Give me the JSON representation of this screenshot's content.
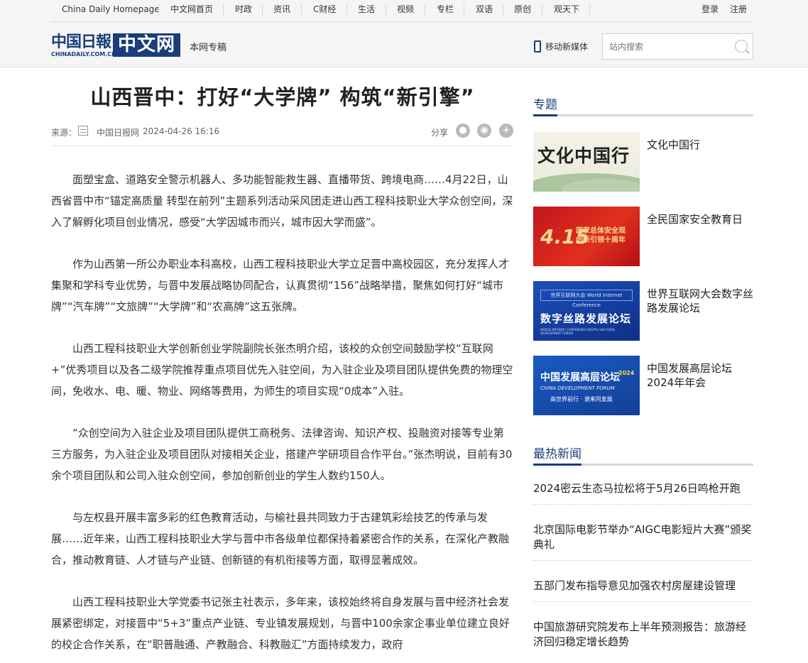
{
  "nav": {
    "items": [
      "China Daily Homepage",
      "中文网首页",
      "时政",
      "资讯",
      "C财经",
      "生活",
      "视频",
      "专栏",
      "双语",
      "原创",
      "观天下"
    ],
    "login": "登录",
    "register": "注册"
  },
  "logo": {
    "cn": "中国日報",
    "en": "CHINADAILY.COM.CN",
    "box": "中文网"
  },
  "header": {
    "column": "本网专稿",
    "mobile": "移动新媒体",
    "search_placeholder": "站内搜索"
  },
  "article": {
    "title": "山西晋中：打好“大学牌” 构筑“新引擎”",
    "source_label": "来源：",
    "source_name": "中国日报网",
    "date": "2024-04-26 16:16",
    "share_label": "分享",
    "paragraphs": [
      "面塑宝盒、道路安全警示机器人、多功能智能救生器、直播带货、跨境电商……4月22日，山西省晋中市“锚定高质量 转型在前列”主题系列活动采风团走进山西工程科技职业大学众创空间，深入了解孵化项目创业情况，感受“大学因城市而兴，城市因大学而盛”。",
      "作为山西第一所公办职业本科高校，山西工程科技职业大学立足晋中高校园区，充分发挥人才集聚和学科专业优势，与晋中发展战略协同配合，认真贯彻“156”战略举措，聚焦如何打好“城市牌”“汽车牌”“文旅牌”“大学牌”和“农高牌”这五张牌。",
      "山西工程科技职业大学创新创业学院副院长张杰明介绍，该校的众创空间鼓励学校“互联网+”优秀项目以及各二级学院推荐重点项目优先入驻空间，为入驻企业及项目团队提供免费的物理空间，免收水、电、暖、物业、网络等费用，为师生的项目实现“0成本”入驻。",
      "“众创空间为入驻企业及项目团队提供工商税务、法律咨询、知识产权、投融资对接等专业第三方服务，为入驻企业及项目团队对接相关企业，搭建产学研项目合作平台。”张杰明说，目前有30余个项目团队和公司入驻众创空间，参加创新创业的学生人数约150人。",
      "与左权县开展丰富多彩的红色教育活动，与榆社县共同致力于古建筑彩绘技艺的传承与发展……近年来，山西工程科技职业大学与晋中市各级单位都保持着紧密合作的关系，在深化产教融合，推动教育链、人才链与产业链、创新链的有机衔接等方面，取得显著成效。",
      "山西工程科技职业大学党委书记张主社表示，多年来，该校始终将自身发展与晋中经济社会发展紧密绑定，对接晋中“5+3”重点产业链、专业镇发展规划，与晋中100余家企事业单位建立良好的校企合作关系，在“职普融通、产教融合、科教融汇”方面持续发力，政府"
    ]
  },
  "sidebar": {
    "topics_title": "专题",
    "topics": [
      {
        "label": "文化中国行",
        "thumb_text": "文化中国行"
      },
      {
        "label": "全民国家安全教育日",
        "thumb_big": "4.15",
        "thumb_text": "国家总体安全观\n创新引领十周年"
      },
      {
        "label": "世界互联网大会数字丝路发展论坛",
        "thumb_small": "世界互联网大会 World Internet Conference",
        "thumb_text": "数字丝路发展论坛",
        "thumb_foot": "WORLD INTERNET CONFERENCE DIGITAL SILK ROAD DEVELOPMENT FORUM"
      },
      {
        "label": "中国发展高层论坛2024年年会",
        "thumb_text": "中国发展高层论坛",
        "thumb_year": "2024",
        "thumb_sub": "CHINA DEVELOPMENT FORUM",
        "thumb_sub2": "高世界前行 · 谱来同发展"
      }
    ],
    "hot_title": "最热新闻",
    "hot": [
      "2024密云生态马拉松将于5月26日鸣枪开跑",
      "北京国际电影节举办“AIGC电影短片大赛”颁奖典礼",
      "五部门发布指导意见加强农村房屋建设管理",
      "中国旅游研究院发布上半年预测报告：旅游经济回归稳定增长趋势"
    ]
  }
}
